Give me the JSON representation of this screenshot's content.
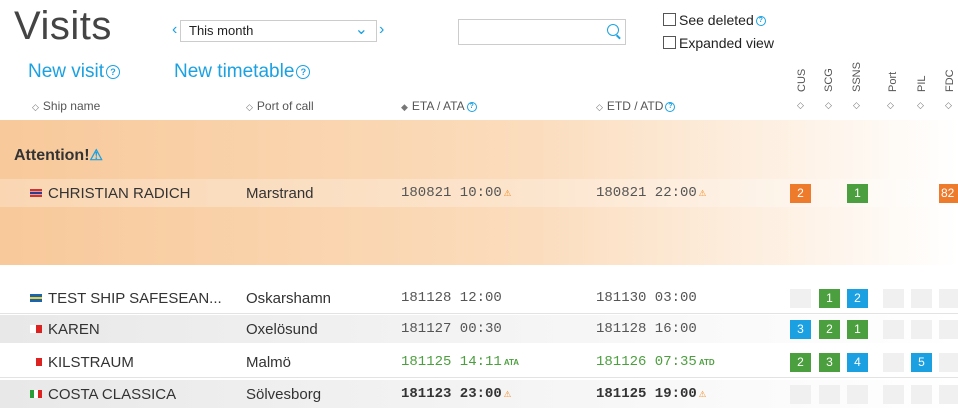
{
  "header": {
    "title": "Visits",
    "period": "This month",
    "new_visit": "New visit",
    "new_timetable": "New timetable",
    "search_value": "",
    "see_deleted": "See deleted",
    "expanded_view": "Expanded view"
  },
  "columns": {
    "ship_name": "Ship name",
    "port_of_call": "Port of call",
    "eta": "ETA / ATA",
    "etd": "ETD / ATD",
    "status": [
      "CUS",
      "SCG",
      "SSNS",
      "Port",
      "PIL",
      "FDC"
    ]
  },
  "attention_label": "Attention!",
  "attention_rows": [
    {
      "flag": "norway",
      "ship": "CHRISTIAN RADICH",
      "port": "Marstrand",
      "eta": "180821 10:00",
      "etd": "180821 22:00",
      "badges": [
        {
          "value": "2",
          "color": "orange"
        },
        {
          "value": "",
          "color": "none"
        },
        {
          "value": "1",
          "color": "green"
        },
        {
          "value": "",
          "color": "none"
        },
        {
          "value": "",
          "color": "none"
        },
        {
          "value": "82",
          "color": "orange"
        }
      ]
    }
  ],
  "rows": [
    {
      "flag": "sweden",
      "ship": "TEST SHIP SAFESEAN...",
      "port": "Oskarshamn",
      "eta": "181128 12:00",
      "etd": "181130 03:00",
      "badges": [
        {
          "value": "",
          "color": "none"
        },
        {
          "value": "1",
          "color": "green"
        },
        {
          "value": "2",
          "color": "blue"
        },
        {
          "value": "",
          "color": "none"
        },
        {
          "value": "",
          "color": "none"
        },
        {
          "value": "",
          "color": "none"
        }
      ]
    },
    {
      "flag": "malta",
      "ship": "KAREN",
      "port": "Oxelösund",
      "eta": "181127 00:30",
      "etd": "181128 16:00",
      "badges": [
        {
          "value": "3",
          "color": "blue"
        },
        {
          "value": "2",
          "color": "green"
        },
        {
          "value": "1",
          "color": "green"
        },
        {
          "value": "",
          "color": "none"
        },
        {
          "value": "",
          "color": "none"
        },
        {
          "value": "",
          "color": "none"
        }
      ]
    },
    {
      "flag": "malta",
      "ship": "KILSTRAUM",
      "port": "Malmö",
      "eta": "181125 14:11",
      "eta_tag": "ATA",
      "etd": "181126 07:35",
      "etd_tag": "ATD",
      "badges": [
        {
          "value": "2",
          "color": "green"
        },
        {
          "value": "3",
          "color": "green"
        },
        {
          "value": "4",
          "color": "blue"
        },
        {
          "value": "",
          "color": "none"
        },
        {
          "value": "5",
          "color": "blue"
        },
        {
          "value": "",
          "color": "none"
        }
      ]
    },
    {
      "flag": "italy",
      "ship": "COSTA CLASSICA",
      "port": "Sölvesborg",
      "eta": "181123 23:00",
      "etd": "181125 19:00",
      "badges": [
        {
          "value": "",
          "color": "none"
        },
        {
          "value": "",
          "color": "none"
        },
        {
          "value": "",
          "color": "none"
        },
        {
          "value": "",
          "color": "none"
        },
        {
          "value": "",
          "color": "none"
        },
        {
          "value": "",
          "color": "none"
        }
      ]
    }
  ]
}
